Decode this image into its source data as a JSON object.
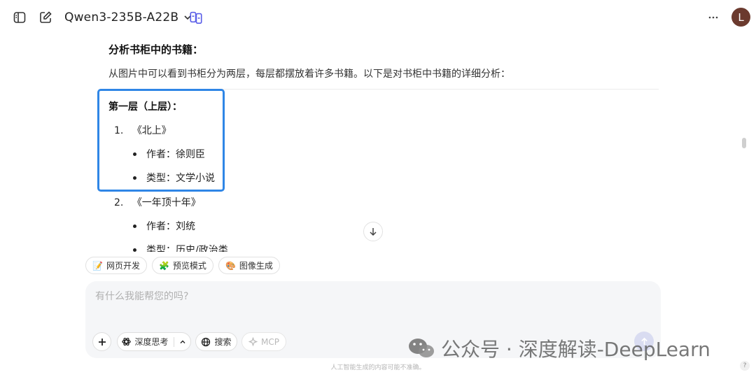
{
  "header": {
    "model_name": "Qwen3-235B-A22B",
    "avatar_initial": "L",
    "accent_color": "#5b5fe8"
  },
  "message": {
    "heading": "分析书柜中的书籍：",
    "intro": "从图片中可以看到书柜分为两层，每层都摆放着许多书籍。以下是对书柜中书籍的详细分析：",
    "section_title": "第一层（上层）：",
    "books": [
      {
        "index": "1.",
        "title": "《北上》",
        "details": [
          "作者：徐则臣",
          "类型：文学小说"
        ]
      },
      {
        "index": "2.",
        "title": "《一年顶十年》",
        "details": [
          "作者：刘统",
          "类型：历史/政治类"
        ]
      }
    ]
  },
  "chips": [
    {
      "icon": "📝",
      "label": "网页开发"
    },
    {
      "icon": "🧩",
      "label": "预览模式"
    },
    {
      "icon": "🎨",
      "label": "图像生成"
    }
  ],
  "composer": {
    "placeholder": "有什么我能帮您的吗?",
    "value": "",
    "think_label": "深度思考",
    "search_label": "搜索",
    "mcp_label": "MCP"
  },
  "footer": {
    "disclaimer": "人工智能生成的内容可能不准确。",
    "help": "?"
  },
  "watermark": {
    "text": "公众号 · 深度解读-DeepLearn"
  }
}
